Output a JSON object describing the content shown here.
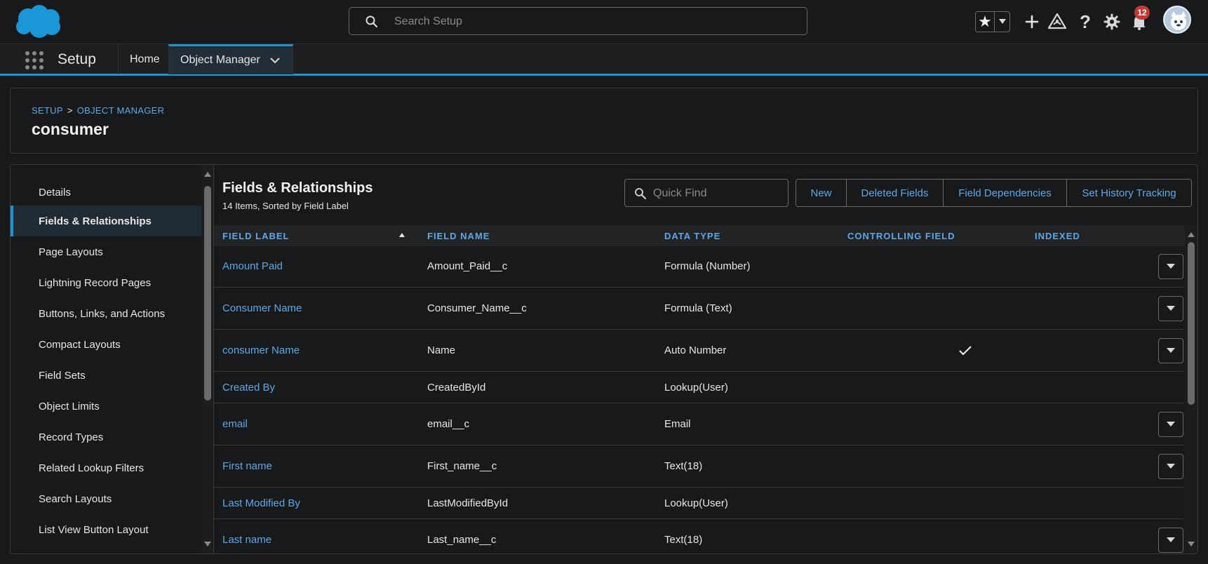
{
  "header": {
    "search_placeholder": "Search Setup",
    "notification_count": "12"
  },
  "context_nav": {
    "app_name": "Setup",
    "tabs": [
      {
        "label": "Home"
      },
      {
        "label": "Object Manager"
      }
    ]
  },
  "page_header": {
    "breadcrumb": [
      "SETUP",
      "OBJECT MANAGER"
    ],
    "breadcrumb_sep": ">",
    "title": "consumer"
  },
  "sidenav": {
    "items": [
      {
        "label": "Details"
      },
      {
        "label": "Fields & Relationships"
      },
      {
        "label": "Page Layouts"
      },
      {
        "label": "Lightning Record Pages"
      },
      {
        "label": "Buttons, Links, and Actions"
      },
      {
        "label": "Compact Layouts"
      },
      {
        "label": "Field Sets"
      },
      {
        "label": "Object Limits"
      },
      {
        "label": "Record Types"
      },
      {
        "label": "Related Lookup Filters"
      },
      {
        "label": "Search Layouts"
      },
      {
        "label": "List View Button Layout"
      }
    ],
    "active_index": 1
  },
  "content": {
    "title": "Fields & Relationships",
    "subtitle": "14 Items, Sorted by Field Label",
    "quick_find_placeholder": "Quick Find",
    "buttons": [
      {
        "label": "New"
      },
      {
        "label": "Deleted Fields"
      },
      {
        "label": "Field Dependencies"
      },
      {
        "label": "Set History Tracking"
      }
    ]
  },
  "table": {
    "columns": [
      "FIELD LABEL",
      "FIELD NAME",
      "DATA TYPE",
      "CONTROLLING FIELD",
      "INDEXED"
    ],
    "rows": [
      {
        "label": "Amount Paid",
        "name": "Amount_Paid__c",
        "type": "Formula (Number)",
        "controlling": "",
        "indexed": false,
        "has_action": true
      },
      {
        "label": "Consumer Name",
        "name": "Consumer_Name__c",
        "type": "Formula (Text)",
        "controlling": "",
        "indexed": false,
        "has_action": true
      },
      {
        "label": "consumer Name",
        "name": "Name",
        "type": "Auto Number",
        "controlling": "",
        "indexed": true,
        "has_action": true
      },
      {
        "label": "Created By",
        "name": "CreatedById",
        "type": "Lookup(User)",
        "controlling": "",
        "indexed": false,
        "has_action": false
      },
      {
        "label": "email",
        "name": "email__c",
        "type": "Email",
        "controlling": "",
        "indexed": false,
        "has_action": true
      },
      {
        "label": "First name",
        "name": "First_name__c",
        "type": "Text(18)",
        "controlling": "",
        "indexed": false,
        "has_action": true
      },
      {
        "label": "Last Modified By",
        "name": "LastModifiedById",
        "type": "Lookup(User)",
        "controlling": "",
        "indexed": false,
        "has_action": false
      },
      {
        "label": "Last name",
        "name": "Last_name__c",
        "type": "Text(18)",
        "controlling": "",
        "indexed": false,
        "has_action": true
      }
    ]
  },
  "colors": {
    "accent": "#1b96d6",
    "link": "#5fa8e8",
    "badge": "#c23934",
    "background": "#18191b"
  },
  "icons": {
    "logo": "salesforce-cloud-logo",
    "search": "search-icon",
    "favorite": "star-icon",
    "add": "plus-icon",
    "trailhead": "trailhead-icon",
    "help": "question-icon",
    "settings": "gear-icon",
    "notifications": "bell-icon"
  }
}
